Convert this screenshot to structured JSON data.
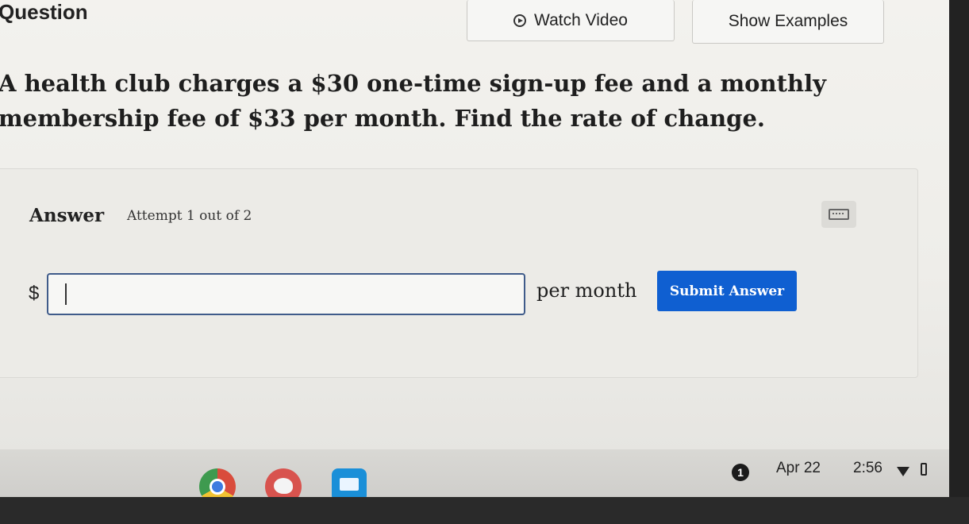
{
  "header": {
    "title": "Question",
    "watch_video_label": "Watch Video",
    "show_examples_label": "Show Examples"
  },
  "question": {
    "text": "A health club charges a $30 one-time sign-up fee and a monthly membership fee of $33 per month. Find the rate of change."
  },
  "answer": {
    "label": "Answer",
    "attempt": "Attempt 1 out of 2",
    "prefix": "$",
    "input_value": "",
    "unit": "per month",
    "submit_label": "Submit Answer",
    "submit_color": "#0f5fd1"
  },
  "taskbar": {
    "apps": [
      "chrome-icon",
      "paint-icon",
      "classroom-icon"
    ],
    "notification_count": "1",
    "date": "Apr 22",
    "time": "2:56"
  }
}
